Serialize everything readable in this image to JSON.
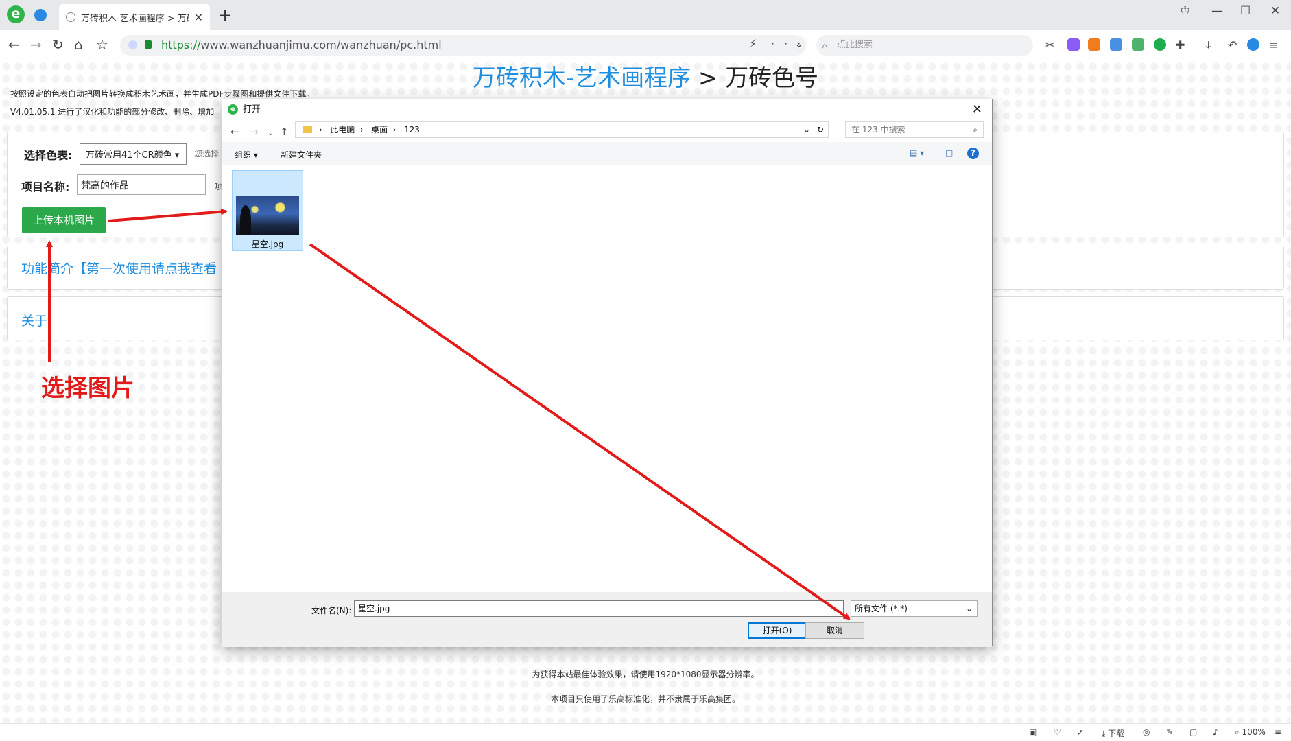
{
  "browser": {
    "tab_title": "万砖积木-艺术画程序 > 万砖色",
    "url_https": "https://",
    "url_rest": "www.wanzhuanjimu.com/wanzhuan/pc.html",
    "search_placeholder": "点此搜索",
    "ie_letter": "e"
  },
  "page": {
    "title_blue": "万砖积木-艺术画程序",
    "title_sep": " > ",
    "title_dark": "万砖色号",
    "desc1": "按照设定的色表自动把图片转换成积木艺术画，并生成PDF步骤图和提供文件下载。",
    "desc2": "V4.01.05.1 进行了汉化和功能的部分修改、删除、增加",
    "palette_label": "选择色表:",
    "palette_value": "万砖常用41个CR颜色",
    "palette_hint": "您选择",
    "project_label": "项目名称:",
    "project_value": "梵高的作品",
    "project_hint": "项",
    "upload_button": "上传本机图片",
    "intro_link": "功能简介【第一次使用请点我查看",
    "about_link": "关于",
    "annotation": "选择图片",
    "footer1": "为获得本站最佳体验效果，请使用1920*1080显示器分辨率。",
    "footer2": "本项目只使用了乐高标准化，并不隶属于乐高集团。"
  },
  "status": {
    "download": "下载",
    "zoom": "100%"
  },
  "dialog": {
    "title": "打开",
    "ie_letter": "e",
    "crumbs": [
      "此电脑",
      "桌面",
      "123"
    ],
    "search_placeholder": "在 123 中搜索",
    "organize": "组织 ▾",
    "new_folder": "新建文件夹",
    "file_name": "星空.jpg",
    "filename_label": "文件名(N):",
    "filename_value": "星空.jpg",
    "filetype": "所有文件 (*.*)",
    "open_button": "打开(O)",
    "cancel_button": "取消",
    "help": "?"
  },
  "colors": {
    "accent": "#1e8ee0",
    "green": "#2aa84a",
    "annotation_red": "#e31a1a"
  }
}
